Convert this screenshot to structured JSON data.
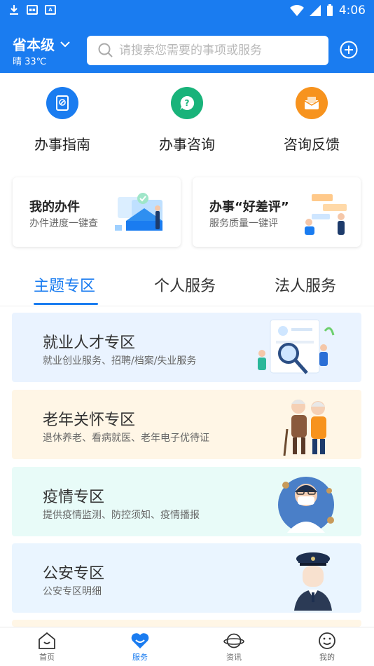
{
  "status_bar": {
    "time": "4:06",
    "icons": [
      "download-icon",
      "app-badge-icon",
      "a-badge-icon",
      "wifi-icon",
      "signal-icon",
      "battery-icon"
    ]
  },
  "header": {
    "region": "省本级",
    "weather": "晴 33℃",
    "search_placeholder": "请搜索您需要的事项或服务"
  },
  "quick_actions": [
    {
      "label": "办事指南",
      "icon": "guide-book-icon",
      "color": "#1a7cf0"
    },
    {
      "label": "办事咨询",
      "icon": "question-chat-icon",
      "color": "#19b37a"
    },
    {
      "label": "咨询反馈",
      "icon": "mail-icon",
      "color": "#f7931e"
    }
  ],
  "cards": [
    {
      "title": "我的办件",
      "subtitle": "办件进度一键查"
    },
    {
      "title": "办事“好差评”",
      "subtitle": "服务质量一键评"
    }
  ],
  "tabs": [
    {
      "label": "主题专区",
      "active": true
    },
    {
      "label": "个人服务",
      "active": false
    },
    {
      "label": "法人服务",
      "active": false
    }
  ],
  "zones": [
    {
      "title": "就业人才专区",
      "subtitle": "就业创业服务、招聘/档案/失业服务",
      "bg": "#eaf3ff"
    },
    {
      "title": "老年关怀专区",
      "subtitle": "退休养老、看病就医、老年电子优待证",
      "bg": "#fff6e6"
    },
    {
      "title": "疫情专区",
      "subtitle": "提供疫情监测、防控须知、疫情播报",
      "bg": "#e8fbf8"
    },
    {
      "title": "公安专区",
      "subtitle": "公安专区明细",
      "bg": "#eaf5ff"
    }
  ],
  "bottom_nav": [
    {
      "label": "首页",
      "icon": "home-icon",
      "active": false
    },
    {
      "label": "服务",
      "icon": "heart-icon",
      "active": true
    },
    {
      "label": "资讯",
      "icon": "planet-icon",
      "active": false
    },
    {
      "label": "我的",
      "icon": "smile-icon",
      "active": false
    }
  ],
  "colors": {
    "primary": "#1a7cf0"
  }
}
